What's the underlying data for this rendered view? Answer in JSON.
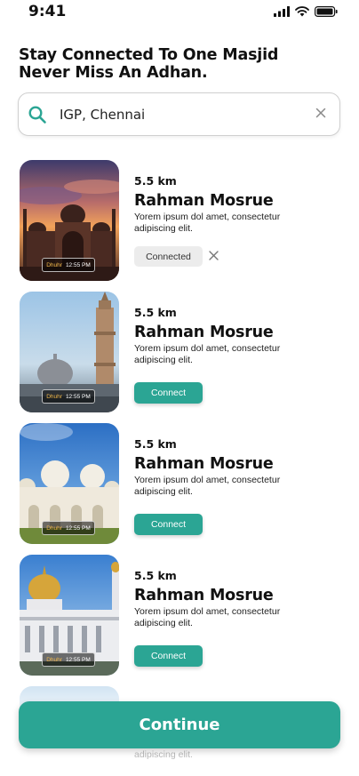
{
  "status_bar": {
    "time": "9:41"
  },
  "headline": "Stay Connected To One Masjid  Never Miss An Adhan.",
  "search": {
    "value": "IGP, Chennai"
  },
  "mosques": [
    {
      "distance": "5.5 km",
      "name": "Rahman Mosrue",
      "description": "Yorem ipsum dol amet, consectetur adipiscing elit.",
      "prayer_name": "Dhuhr",
      "prayer_time": "12:55 PM",
      "action_label": "Connected",
      "connected": true
    },
    {
      "distance": "5.5 km",
      "name": "Rahman Mosrue",
      "description": "Yorem ipsum dol amet, consectetur adipiscing elit.",
      "prayer_name": "Dhuhr",
      "prayer_time": "12:55 PM",
      "action_label": "Connect",
      "connected": false
    },
    {
      "distance": "5.5 km",
      "name": "Rahman Mosrue",
      "description": "Yorem ipsum dol amet, consectetur adipiscing elit.",
      "prayer_name": "Dhuhr",
      "prayer_time": "12:55 PM",
      "action_label": "Connect",
      "connected": false
    },
    {
      "distance": "5.5 km",
      "name": "Rahman Mosrue",
      "description": "Yorem ipsum dol amet, consectetur adipiscing elit.",
      "prayer_name": "Dhuhr",
      "prayer_time": "12:55 PM",
      "action_label": "Connect",
      "connected": false
    }
  ],
  "peek_item": {
    "description_fragment": "adipiscing elit."
  },
  "continue_label": "Continue",
  "colors": {
    "accent": "#2ba594",
    "connected_bg": "#ececec"
  },
  "icons": {
    "search": "search-icon",
    "clear": "close-icon",
    "remove": "close-icon"
  }
}
